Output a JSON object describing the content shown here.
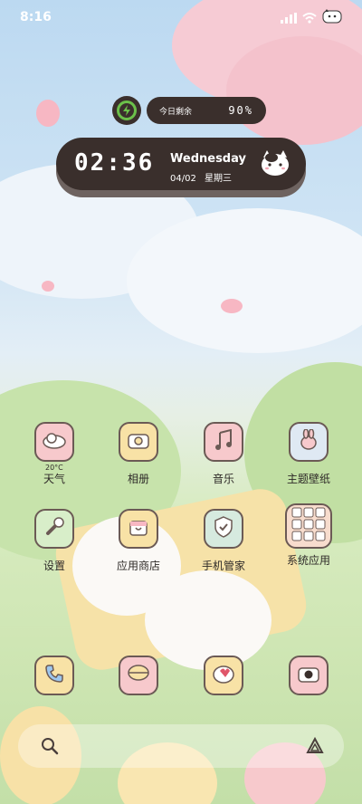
{
  "status_bar": {
    "time": "8:16"
  },
  "battery_widget": {
    "label": "今日剩余",
    "percent": "90%",
    "level": 0.9,
    "ring_color": "#6bc04a"
  },
  "clock_widget": {
    "time": "02:36",
    "weekday": "Wednesday",
    "date": "04/02",
    "weekday_cn": "星期三"
  },
  "apps": {
    "weather": {
      "label": "天气",
      "temp": "20°C",
      "icon": "cloud-icon",
      "color": "#f7c9cc"
    },
    "album": {
      "label": "相册",
      "icon": "camera-icon",
      "color": "#f8e2a6"
    },
    "music": {
      "label": "音乐",
      "icon": "music-note-icon",
      "color": "#f7c9cc"
    },
    "theme": {
      "label": "主题壁纸",
      "icon": "bunny-icon",
      "color": "#dfe9f3"
    },
    "settings": {
      "label": "设置",
      "icon": "wrench-icon",
      "color": "#d8eec9"
    },
    "app_store": {
      "label": "应用商店",
      "icon": "store-bag-icon",
      "color": "#f8e2a6"
    },
    "phone_manager": {
      "label": "手机管家",
      "icon": "shield-check-icon",
      "color": "#d6eadf"
    },
    "system_apps": {
      "label": "系统应用",
      "icon": "app-folder-icon",
      "color": "#f7dccd"
    }
  },
  "dock": [
    {
      "icon": "phone-icon",
      "color": "#f8e2a6"
    },
    {
      "icon": "message-bubble-icon",
      "color": "#f7c9cc"
    },
    {
      "icon": "browser-icon",
      "color": "#f8e2a6"
    },
    {
      "icon": "camera-icon",
      "color": "#f7c9cc"
    }
  ],
  "bottom_bar": {
    "left_icon": "search-icon",
    "right_icon": "assistant-icon"
  }
}
